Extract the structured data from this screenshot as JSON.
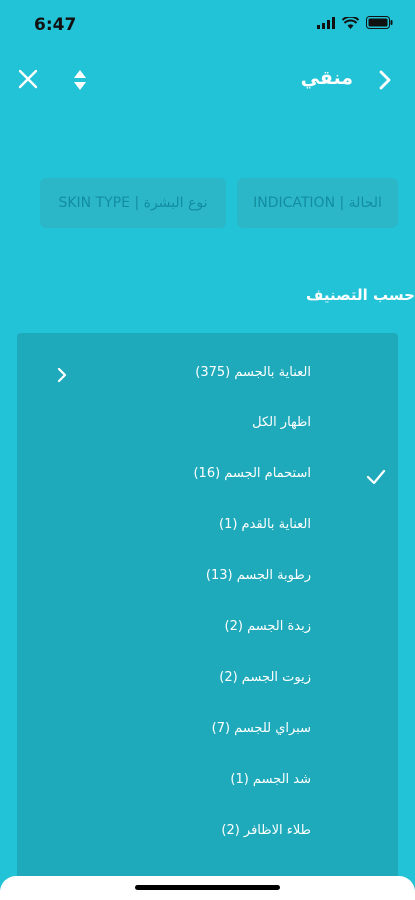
{
  "status": {
    "time": "6:47"
  },
  "nav": {
    "title": "منقي"
  },
  "filters": {
    "skin_type": "SKIN TYPE | نوع البشرة",
    "indication": "INDICATION | الحالة"
  },
  "section": {
    "title": "حسب التصنيف"
  },
  "categories": [
    {
      "label": "العناية بالجسم  (375)",
      "chevron": true,
      "checked": false
    },
    {
      "label": "اظهار الكل",
      "chevron": false,
      "checked": false
    },
    {
      "label": "استحمام الجسم  (16)",
      "chevron": false,
      "checked": true
    },
    {
      "label": "العناية بالقدم  (1)",
      "chevron": false,
      "checked": false
    },
    {
      "label": "رطوبة الجسم  (13)",
      "chevron": false,
      "checked": false
    },
    {
      "label": "زبدة الجسم  (2)",
      "chevron": false,
      "checked": false
    },
    {
      "label": "زيوت الجسم  (2)",
      "chevron": false,
      "checked": false
    },
    {
      "label": "سبراي للجسم  (7)",
      "chevron": false,
      "checked": false
    },
    {
      "label": "شد الجسم  (1)",
      "chevron": false,
      "checked": false
    },
    {
      "label": "طلاء الاظافر  (2)",
      "chevron": false,
      "checked": false
    }
  ],
  "icons": [
    "close-icon",
    "sort-icon",
    "chevron-right-icon",
    "check-icon"
  ],
  "colors": {
    "background": "#22c3d6",
    "menu": "#1faabb",
    "chip": "#2cb7c9",
    "chip_text": "#128da0"
  }
}
